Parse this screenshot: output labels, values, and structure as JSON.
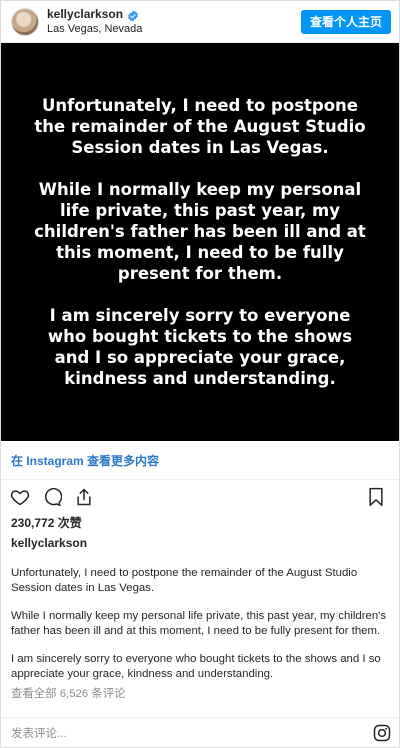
{
  "header": {
    "username": "kellyclarkson",
    "location": "Las Vegas, Nevada",
    "profile_button": "查看个人主页"
  },
  "post_image_text": [
    "Unfortunately, I need to postpone the remainder of the August Studio Session dates in Las Vegas.",
    "While I normally keep my personal life private, this past year, my children's father has been ill and at this moment, I need to be fully present for them.",
    "I am sincerely sorry to everyone who bought tickets to the shows and I so appreciate your grace, kindness and understanding."
  ],
  "view_more": "在 Instagram 查看更多内容",
  "likes": "230,772 次赞",
  "owner": "kellyclarkson",
  "caption": [
    "Unfortunately, I need to postpone the remainder of the August Studio Session dates in Las Vegas.",
    "While I normally keep my personal life private, this past year, my children's father has been ill and at this moment, I need to be fully present for them.",
    "I am sincerely sorry to everyone who bought tickets to the shows and I so appreciate your grace, kindness and understanding."
  ],
  "view_comments": "查看全部 6,526 条评论",
  "comment_placeholder": "发表评论...",
  "colors": {
    "accent": "#0095f6",
    "link": "#2d7ac7",
    "image_bg": "#000000"
  },
  "icons": [
    "verified-badge-icon",
    "heart-icon",
    "comment-icon",
    "share-icon",
    "bookmark-icon",
    "instagram-icon"
  ]
}
